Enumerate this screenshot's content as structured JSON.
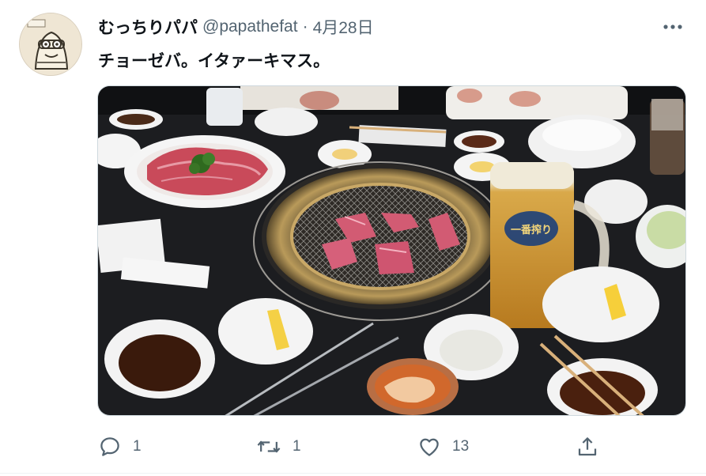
{
  "tweet": {
    "display_name": "むっちりパパ",
    "handle": "@papathefat",
    "separator": "·",
    "time": "4月28日",
    "text": "チョーゼバ。イタァーキマス。",
    "more_icon": "ellipsis-icon"
  },
  "media": {
    "description_icon": "photo",
    "glass_logo": "一番搾り"
  },
  "actions": {
    "reply": {
      "icon": "reply-icon",
      "count": "1"
    },
    "retweet": {
      "icon": "retweet-icon",
      "count": "1"
    },
    "like": {
      "icon": "heart-icon",
      "count": "13"
    },
    "share": {
      "icon": "share-icon"
    }
  },
  "colors": {
    "text_primary": "#0f1419",
    "text_secondary": "#536471",
    "border": "#cfd9de"
  }
}
